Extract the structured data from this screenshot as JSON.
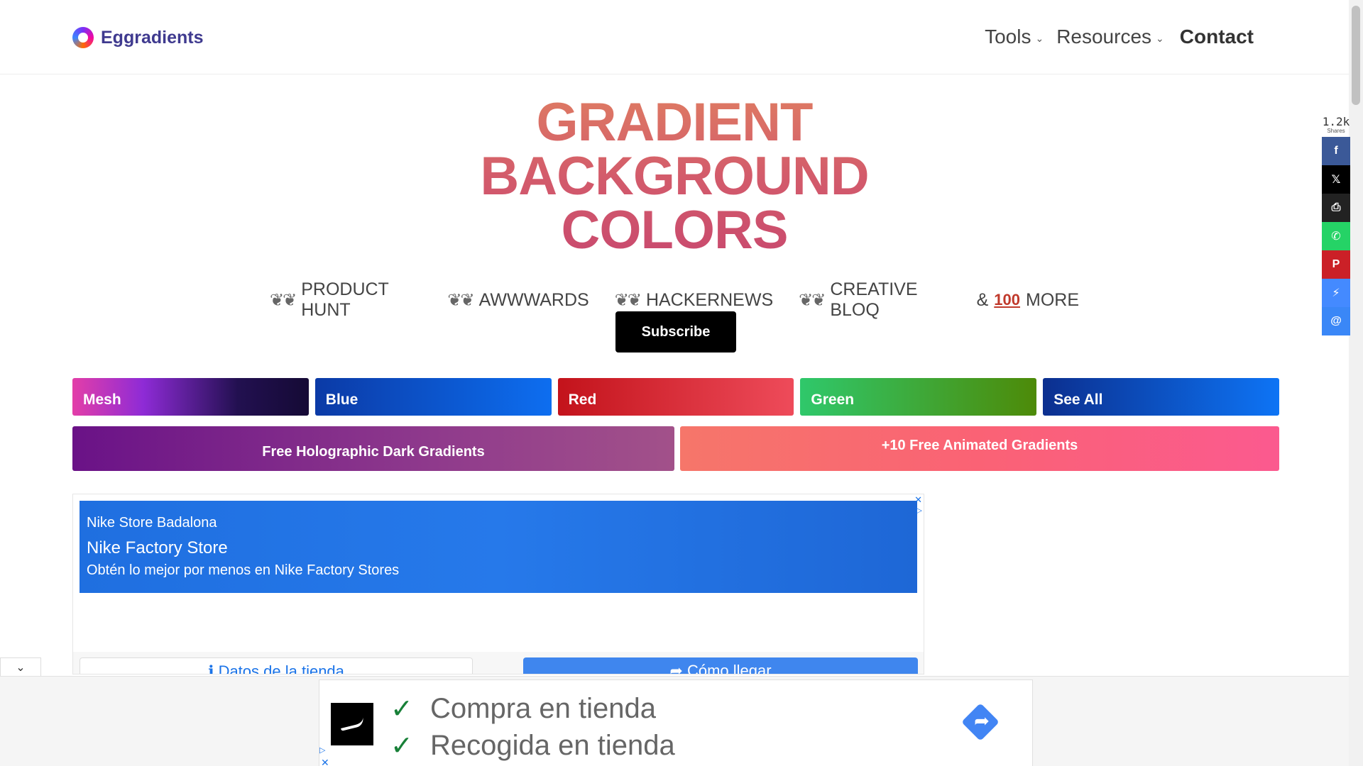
{
  "header": {
    "logo_text": "Eggradients",
    "nav": [
      {
        "label": "Tools",
        "has_dropdown": true
      },
      {
        "label": "Resources",
        "has_dropdown": true
      },
      {
        "label": "Contact",
        "has_dropdown": false
      }
    ]
  },
  "hero": {
    "title_lines": [
      "GRADIENT",
      "BACKGROUND",
      "COLORS"
    ],
    "awards": [
      "PRODUCT HUNT",
      "AWWWARDS",
      "HACKERNEWS",
      "CREATIVE BLOQ"
    ],
    "more_prefix": "&",
    "more_badge": "100",
    "more_label": "MORE",
    "subscribe_label": "Subscribe"
  },
  "categories": [
    "Mesh",
    "Blue",
    "Red",
    "Green",
    "See All"
  ],
  "promos": [
    "Free Holographic Dark Gradients",
    "+10 Free Animated Gradients"
  ],
  "share": {
    "count": "1.2k",
    "label": "Shares",
    "buttons": [
      {
        "name": "facebook",
        "glyph": "f",
        "color": "#3b5998"
      },
      {
        "name": "x",
        "glyph": "𝕏",
        "color": "#000000"
      },
      {
        "name": "print",
        "glyph": "⎙",
        "color": "#222222"
      },
      {
        "name": "whatsapp",
        "glyph": "✆",
        "color": "#25d366"
      },
      {
        "name": "pinterest",
        "glyph": "P",
        "color": "#cb2027"
      },
      {
        "name": "messenger",
        "glyph": "⚡",
        "color": "#448aff"
      },
      {
        "name": "email",
        "glyph": "@",
        "color": "#3a87f7"
      }
    ]
  },
  "ad": {
    "store": "Nike Store Badalona",
    "title": "Nike Factory Store",
    "description": "Obtén lo mejor por menos en Nike Factory Stores",
    "info_button": "Datos de la tienda",
    "directions_button": "Cómo llegar",
    "close_glyph": "✕",
    "adchoice_glyph": "▷"
  },
  "sticky_ad": {
    "line1": "Compra en tienda",
    "line2": "Recogida en tienda",
    "check_glyph": "✓",
    "arrow_glyph": "➦"
  },
  "icons": {
    "chevron": "⌄",
    "laurel": "❦❦",
    "info": "ℹ",
    "collapse": "⌄"
  }
}
